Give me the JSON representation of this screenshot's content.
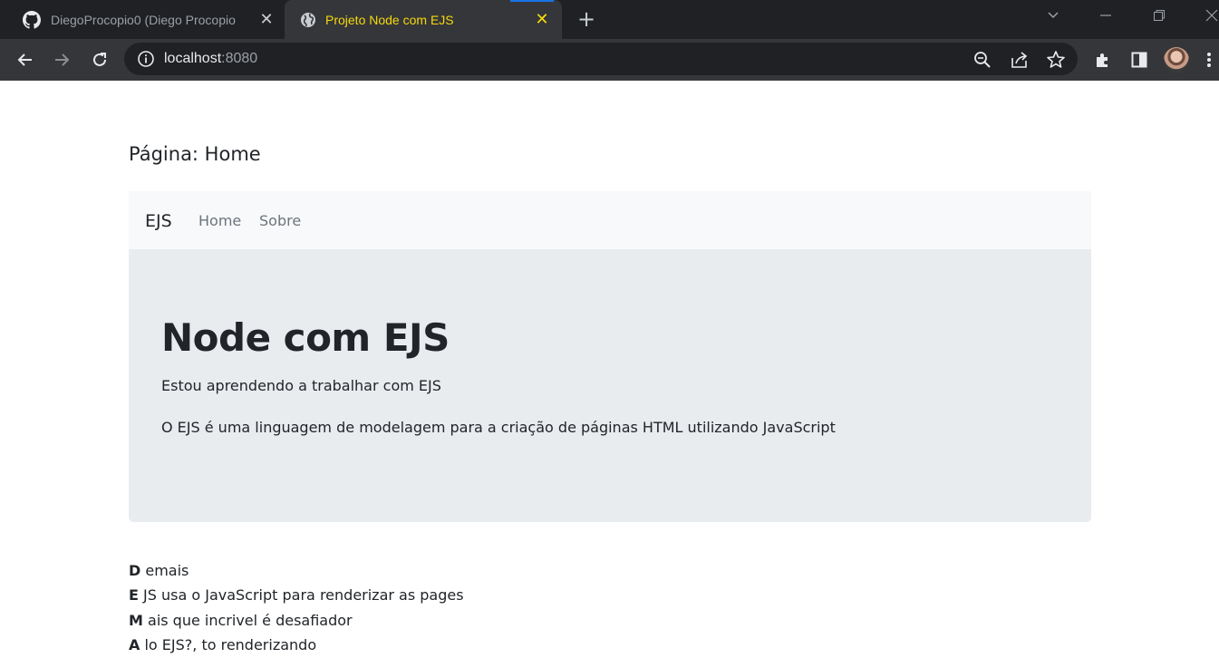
{
  "browser": {
    "tabs": [
      {
        "title": "DiegoProcopio0 (Diego Procopio",
        "icon": "github-icon",
        "active": false
      },
      {
        "title": "Projeto Node com EJS",
        "icon": "globe-icon",
        "active": true
      }
    ],
    "address_bar": {
      "host": "localhost",
      "port": ":8080"
    }
  },
  "page": {
    "title": "Página: Home",
    "navbar": {
      "brand": "EJS",
      "links": [
        {
          "label": "Home"
        },
        {
          "label": "Sobre"
        }
      ]
    },
    "jumbotron": {
      "heading": "Node com EJS",
      "lead": "Estou aprendendo a trabalhar com EJS",
      "text": "O EJS é uma linguagem de modelagem para a criação de páginas HTML utilizando JavaScript"
    },
    "acrostic": [
      {
        "letter": "D",
        "rest": " emais"
      },
      {
        "letter": "E",
        "rest": " JS usa o JavaScript para renderizar as pages"
      },
      {
        "letter": "M",
        "rest": " ais que incrivel é desafiador"
      },
      {
        "letter": "A",
        "rest": " lo EJS?, to renderizando"
      }
    ]
  },
  "colors": {
    "active_tab_title": "#f5d90a",
    "navbar_bg": "#f8f9fa",
    "jumbotron_bg": "#e9ecef",
    "text": "#212529",
    "muted_link": "#6c757d"
  }
}
